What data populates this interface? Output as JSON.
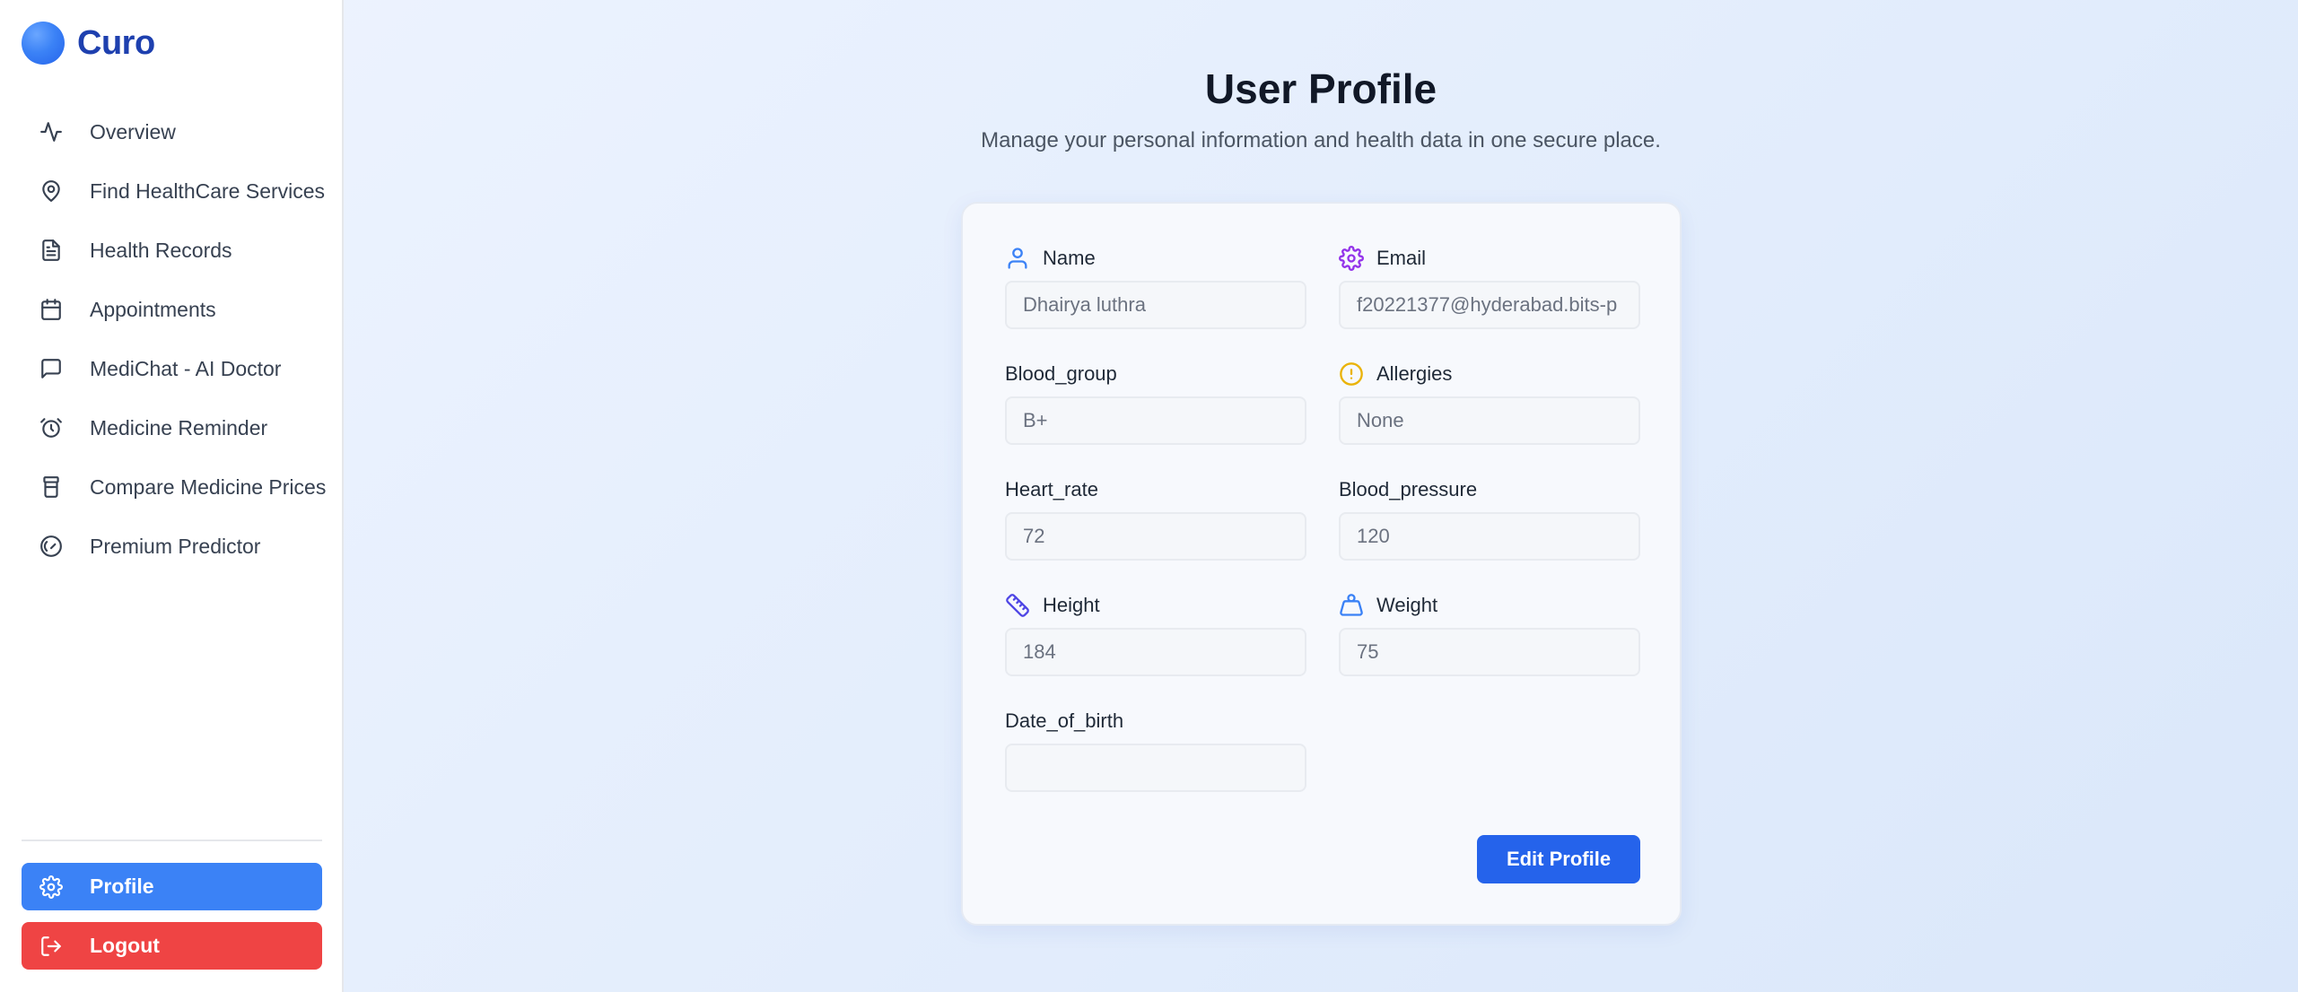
{
  "app": {
    "name": "Curo"
  },
  "sidebar": {
    "items": [
      {
        "label": "Overview",
        "icon": "activity-icon"
      },
      {
        "label": "Find HealthCare Services",
        "icon": "map-pin-icon"
      },
      {
        "label": "Health Records",
        "icon": "file-text-icon"
      },
      {
        "label": "Appointments",
        "icon": "calendar-icon"
      },
      {
        "label": "MediChat - AI Doctor",
        "icon": "message-square-icon"
      },
      {
        "label": "Medicine Reminder",
        "icon": "alarm-clock-icon"
      },
      {
        "label": "Compare Medicine Prices",
        "icon": "pill-bottle-icon"
      },
      {
        "label": "Premium Predictor",
        "icon": "gauge-icon"
      }
    ],
    "profile_label": "Profile",
    "logout_label": "Logout",
    "colors": {
      "profile": "#3b82f6",
      "logout": "#ef4444"
    }
  },
  "page": {
    "title": "User Profile",
    "subtitle": "Manage your personal information and health data in one secure place."
  },
  "form": {
    "name": {
      "label": "Name",
      "value": "Dhairya luthra",
      "icon": "user-icon"
    },
    "email": {
      "label": "Email",
      "value": "f20221377@hyderabad.bits-p",
      "icon": "gear-icon"
    },
    "blood_group": {
      "label": "Blood_group",
      "value": "B+"
    },
    "allergies": {
      "label": "Allergies",
      "value": "None",
      "icon": "alert-circle-icon"
    },
    "heart_rate": {
      "label": "Heart_rate",
      "value": "72"
    },
    "blood_pressure": {
      "label": "Blood_pressure",
      "value": "120"
    },
    "height": {
      "label": "Height",
      "value": "184",
      "icon": "ruler-icon"
    },
    "weight": {
      "label": "Weight",
      "value": "75",
      "icon": "weight-icon"
    },
    "date_of_birth": {
      "label": "Date_of_birth",
      "value": ""
    },
    "edit_button": "Edit Profile"
  },
  "colors": {
    "accent": "#2563eb",
    "brand": "#1e40af"
  }
}
